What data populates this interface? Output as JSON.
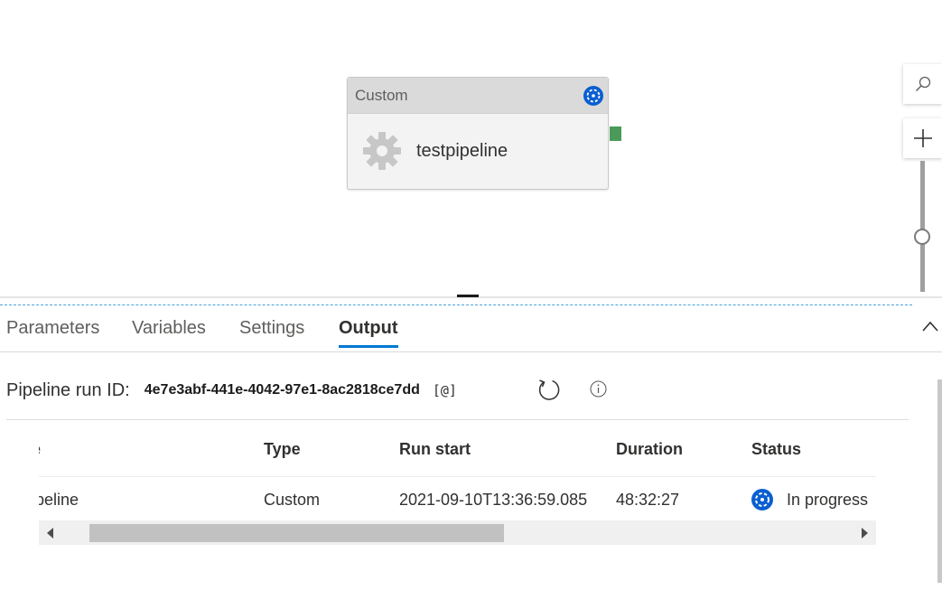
{
  "canvas": {
    "activity": {
      "type": "Custom",
      "name": "testpipeline",
      "status_icon": "in-progress-icon",
      "icon": "gear-icon"
    },
    "zoom": {
      "search_icon": "search-icon",
      "plus_icon": "plus-icon"
    }
  },
  "tabs": [
    {
      "label": "Parameters",
      "active": false
    },
    {
      "label": "Variables",
      "active": false
    },
    {
      "label": "Settings",
      "active": false
    },
    {
      "label": "Output",
      "active": true
    }
  ],
  "output": {
    "run_id_label": "Pipeline run ID:",
    "run_id": "4e7e3abf-441e-4042-97e1-8ac2818ce7dd",
    "copy_label": "[@]",
    "table": {
      "headers": [
        "e",
        "Type",
        "Run start",
        "Duration",
        "Status"
      ],
      "rows": [
        [
          "ipeline",
          "Custom",
          "2021-09-10T13:36:59.085",
          "48:32:27",
          "In progress"
        ]
      ]
    }
  },
  "colors": {
    "accent": "#0078d4",
    "status_blue": "#0a5fd0",
    "connector_green": "#4a9b5a"
  }
}
